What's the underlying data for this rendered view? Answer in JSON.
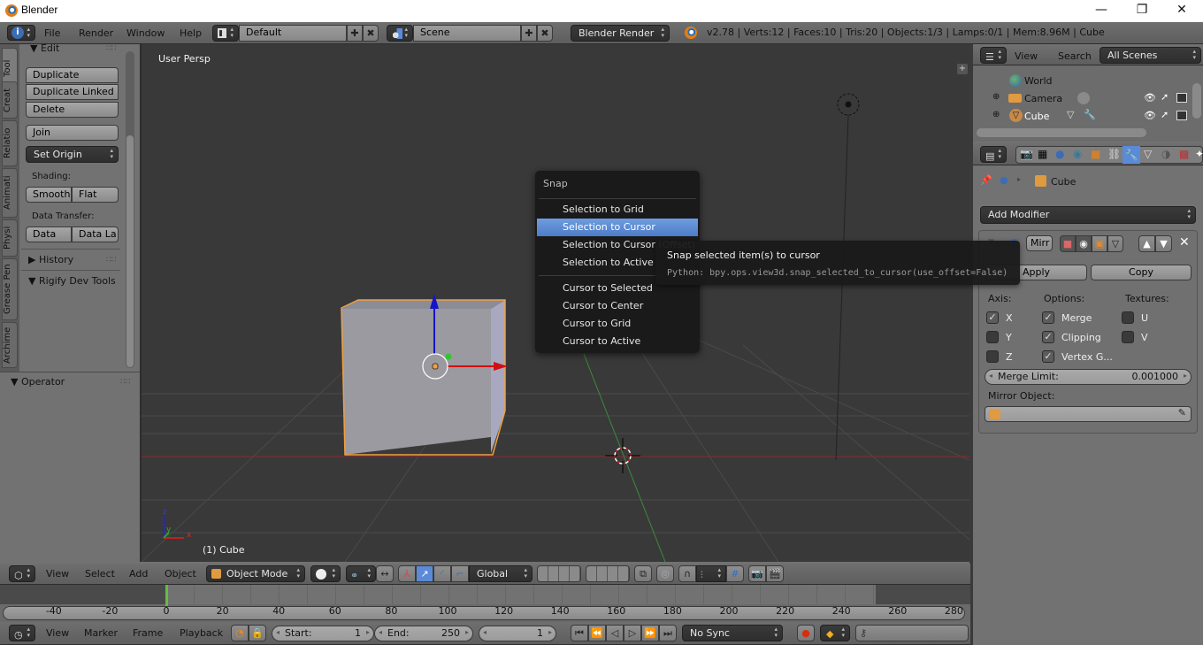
{
  "window": {
    "title": "Blender",
    "controls": {
      "minimize": "—",
      "maximize": "❐",
      "close": "✕"
    }
  },
  "info_header": {
    "menus": [
      "File",
      "Render",
      "Window",
      "Help"
    ],
    "screen_layout": "Default",
    "scene": "Scene",
    "render_engine": "Blender Render",
    "stats": "v2.78 | Verts:12 | Faces:10 | Tris:20 | Objects:1/3 | Lamps:0/1 | Mem:8.96M | Cube"
  },
  "tool_shelf": {
    "tabs": [
      "Tool",
      "Creat",
      "Relatio",
      "Animati",
      "Physi",
      "Grease Pen",
      "Archime"
    ],
    "active_tab": "Tool",
    "edit_panel": {
      "title": "Edit",
      "buttons": [
        "Duplicate",
        "Duplicate Linked",
        "Delete"
      ],
      "join": "Join",
      "set_origin": "Set Origin",
      "shading_label": "Shading:",
      "shading_buttons": [
        "Smooth",
        "Flat"
      ],
      "data_transfer_label": "Data Transfer:",
      "data_transfer_buttons": [
        "Data",
        "Data La"
      ]
    },
    "history": "History",
    "rigify": "Rigify Dev Tools",
    "operator": "Operator"
  },
  "viewport": {
    "view_name": "User Persp",
    "object_label": "(1) Cube",
    "axis_labels": {
      "x": "x",
      "y": "y",
      "z": "z"
    }
  },
  "snap_menu": {
    "title": "Snap",
    "items": [
      {
        "label": "Selection to Grid",
        "highlighted": false
      },
      {
        "label": "Selection to Cursor",
        "highlighted": true
      },
      {
        "label": "Selection to Cursor (Offset)",
        "highlighted": false
      },
      {
        "label": "Selection to Active",
        "highlighted": false
      },
      {
        "label": "Cursor to Selected",
        "highlighted": false
      },
      {
        "label": "Cursor to Center",
        "highlighted": false
      },
      {
        "label": "Cursor to Grid",
        "highlighted": false
      },
      {
        "label": "Cursor to Active",
        "highlighted": false
      }
    ],
    "tooltip": {
      "title": "Snap selected item(s) to cursor",
      "python": "Python: bpy.ops.view3d.snap_selected_to_cursor(use_offset=False)"
    }
  },
  "outliner": {
    "menus": [
      "View",
      "Search"
    ],
    "filter": "All Scenes",
    "items": [
      {
        "name": "World",
        "icon": "world-icon"
      },
      {
        "name": "Camera",
        "icon": "camera-object-icon"
      },
      {
        "name": "Cube",
        "icon": "mesh-object-icon"
      }
    ]
  },
  "properties": {
    "breadcrumb_object": "Cube",
    "add_modifier": "Add Modifier",
    "modifier": {
      "name": "Mirr",
      "apply": "Apply",
      "copy": "Copy",
      "axis_label": "Axis:",
      "options_label": "Options:",
      "textures_label": "Textures:",
      "axis": [
        {
          "label": "X",
          "checked": true
        },
        {
          "label": "Y",
          "checked": false
        },
        {
          "label": "Z",
          "checked": false
        }
      ],
      "options": [
        {
          "label": "Merge",
          "checked": true
        },
        {
          "label": "Clipping",
          "checked": true
        },
        {
          "label": "Vertex G...",
          "checked": true
        }
      ],
      "textures": [
        {
          "label": "U",
          "checked": false
        },
        {
          "label": "V",
          "checked": false
        }
      ],
      "merge_limit_label": "Merge Limit:",
      "merge_limit_value": "0.001000",
      "mirror_object_label": "Mirror Object:",
      "mirror_object_value": ""
    }
  },
  "view3d_header": {
    "menus": [
      "View",
      "Select",
      "Add",
      "Object"
    ],
    "mode": "Object Mode",
    "orientation": "Global"
  },
  "timeline": {
    "ticks": [
      "-40",
      "-20",
      "0",
      "20",
      "40",
      "60",
      "80",
      "100",
      "120",
      "140",
      "160",
      "180",
      "200",
      "220",
      "240",
      "260",
      "280"
    ],
    "current_frame_marker": 0,
    "menus": [
      "View",
      "Marker",
      "Frame",
      "Playback"
    ],
    "start_label": "Start:",
    "start_value": "1",
    "end_label": "End:",
    "end_value": "250",
    "current_frame": "1",
    "sync": "No Sync"
  }
}
